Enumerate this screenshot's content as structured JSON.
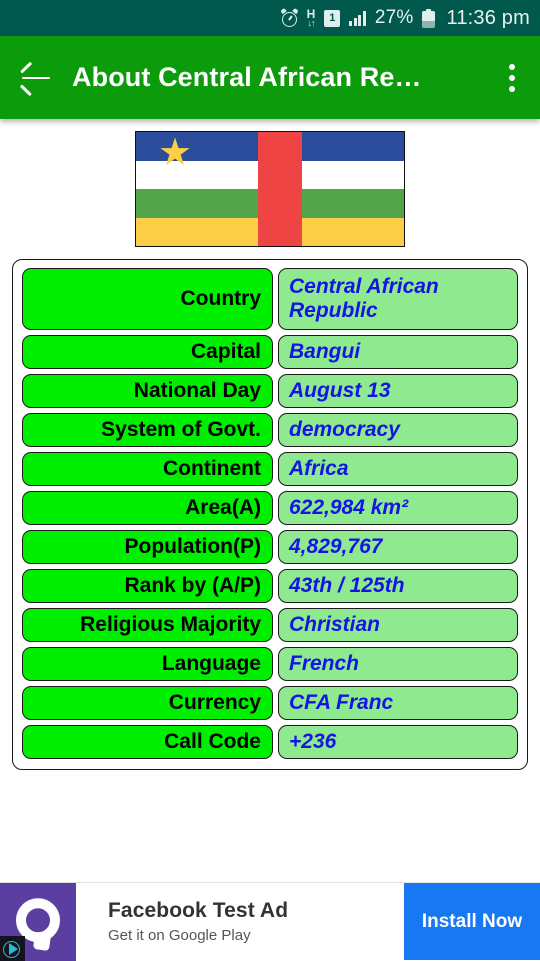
{
  "statusbar": {
    "alarm_icon": "alarm-clock-icon",
    "network_type": "H",
    "network_arrows": "↓↑",
    "sim_slot": "1",
    "signal_icon": "signal-bars-icon",
    "battery_percent": "27%",
    "battery_icon": "battery-icon",
    "time": "11:36 pm"
  },
  "appbar": {
    "back_icon": "back-arrow-icon",
    "title": "About Central African Re…",
    "overflow_icon": "overflow-menu-icon"
  },
  "flag": {
    "name": "central-african-republic-flag",
    "stripes": [
      "#2b4d9b",
      "#ffffff",
      "#51a548",
      "#fbce46"
    ],
    "vertical_stripe": "#ef4444",
    "star": "★",
    "star_color": "#fbce46"
  },
  "colors": {
    "statusbar": "#00594C",
    "appbar": "#0b9b0b",
    "label_cell": "#00ee00",
    "value_cell": "#8fe98f",
    "value_text": "#1414e6",
    "label_text": "#000000",
    "ad_cta": "#1877f2",
    "ad_icon": "#5b3fa0"
  },
  "facts": [
    {
      "label": "Country",
      "value": "Central African Republic",
      "tall": true
    },
    {
      "label": "Capital",
      "value": "Bangui",
      "tall": false
    },
    {
      "label": "National Day",
      "value": "August 13",
      "tall": false
    },
    {
      "label": "System of Govt.",
      "value": "democracy",
      "tall": false
    },
    {
      "label": "Continent",
      "value": "Africa",
      "tall": false
    },
    {
      "label": "Area(A)",
      "value": "622,984 km²",
      "tall": false
    },
    {
      "label": "Population(P)",
      "value": "4,829,767",
      "tall": false
    },
    {
      "label": "Rank by (A/P)",
      "value": "43th / 125th",
      "tall": false
    },
    {
      "label": "Religious Majority",
      "value": "Christian",
      "tall": false
    },
    {
      "label": "Language",
      "value": "French",
      "tall": false
    },
    {
      "label": "Currency",
      "value": "CFA Franc",
      "tall": false
    },
    {
      "label": "Call Code",
      "value": "+236",
      "tall": false
    }
  ],
  "ad": {
    "icon": "facebook-audience-network-app-icon",
    "adchoices_icon": "adchoices-icon",
    "title": "Facebook Test Ad",
    "subtitle": "Get it on Google Play",
    "cta": "Install Now"
  }
}
